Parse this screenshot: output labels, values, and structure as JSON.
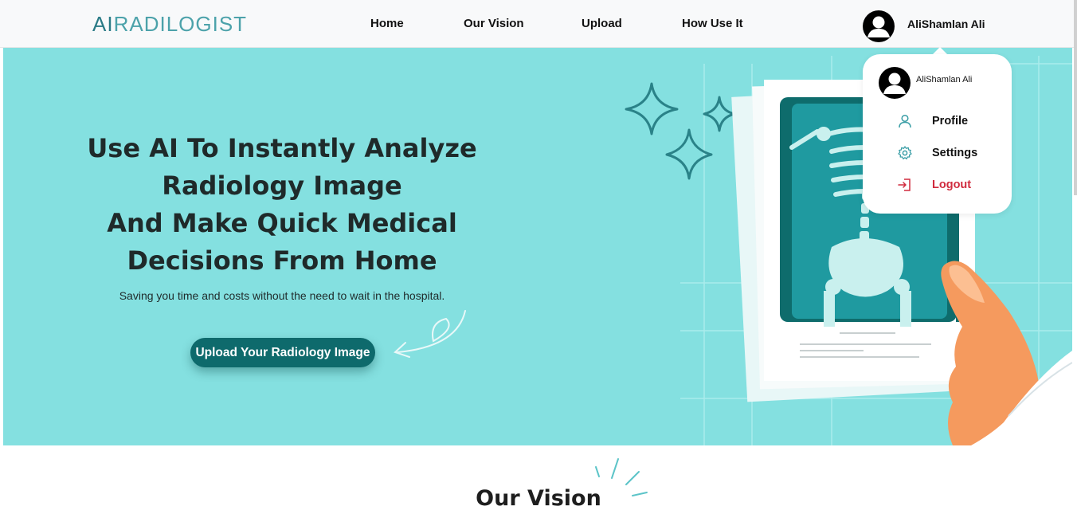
{
  "navbar": {
    "logo_ai": "AI",
    "logo_rest": "RADILOGIST",
    "links": [
      "Home",
      "Our Vision",
      "Upload",
      "How Use It"
    ],
    "user_name": "AliShamlan Ali"
  },
  "dropdown": {
    "user_name": "AliShamlan Ali",
    "items": [
      {
        "label": "Profile",
        "icon": "user-icon"
      },
      {
        "label": "Settings",
        "icon": "gear-icon"
      },
      {
        "label": "Logout",
        "icon": "logout-icon"
      }
    ]
  },
  "hero": {
    "title_lines": [
      "Use AI To Instantly Analyze",
      "Radiology Image",
      "And Make Quick Medical",
      "Decisions From Home"
    ],
    "subtitle": "Saving you time and costs without the need to wait in the hospital.",
    "cta_label": "Upload Your Radiology Image"
  },
  "vision": {
    "title": "Our Vision"
  },
  "colors": {
    "hero_bg": "#84e0e0",
    "cta_bg": "#0e6a6c",
    "logo_ai": "#2a7b86",
    "logout": "#d02b3e",
    "icon_teal": "#3a9ea6"
  }
}
